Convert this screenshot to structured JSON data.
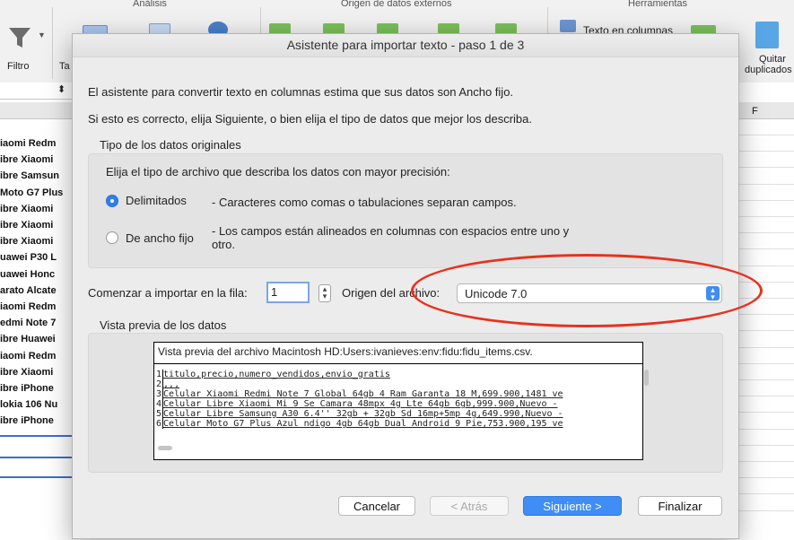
{
  "ribbon": {
    "groups": [
      "Análisis",
      "Origen de datos externos",
      "Herramientas"
    ],
    "filter_label": "Filtro",
    "ta_label": "Ta",
    "text_to_columns": "Texto en columnas",
    "remove_dup_line1": "Quitar",
    "remove_dup_line2": "duplicados"
  },
  "sheet": {
    "col_f": "F",
    "rows": [
      "iaomi Redm",
      "ibre Xiaomi",
      "ibre Samsun",
      "Moto G7 Plus",
      "ibre Xiaomi",
      "ibre Xiaomi",
      "ibre Xiaomi",
      "uawei P30 L",
      "uawei Honc",
      "arato Alcate",
      "iaomi Redm",
      "edmi Note 7",
      "ibre Huawei",
      "iaomi Redm",
      "ibre Xiaomi",
      "ibre iPhone",
      "lokia 106 Nu",
      "ibre iPhone"
    ]
  },
  "dialog": {
    "title": "Asistente para importar texto - paso 1 de 3",
    "intro1": "El asistente para convertir texto en columnas estima que sus datos son Ancho fijo.",
    "intro2": "Si esto es correcto, elija Siguiente, o bien elija el tipo de datos que mejor los describa.",
    "type_group_title": "Tipo de los datos originales",
    "type_prompt": "Elija el tipo de archivo que describa los datos con mayor precisión:",
    "opt_delimited": "Delimitados",
    "opt_delimited_desc": "- Caracteres como comas o tabulaciones separan campos.",
    "opt_fixed": "De ancho fijo",
    "opt_fixed_desc_line1": "- Los campos están alineados en columnas con espacios entre uno y",
    "opt_fixed_desc_line2": "otro.",
    "start_row_label": "Comenzar a importar en la fila:",
    "start_row_value": "1",
    "origin_label": "Origen del archivo:",
    "origin_value": "Unicode 7.0",
    "preview_group_title": "Vista previa de los datos",
    "preview_header": "Vista previa del archivo Macintosh HD:Users:ivanieves:env:fidu:fidu_items.csv.",
    "preview_lines": [
      {
        "num": "1",
        "text": "titulo,precio,numero_vendidos,envio_gratis"
      },
      {
        "num": "2",
        "text": ",,,"
      },
      {
        "num": "3",
        "text": "Celular Xiaomi Redmi Note 7 Global 64gb 4 Ram Garanta 18 M,699.900,1481 ve"
      },
      {
        "num": "4",
        "text": "Celular Libre Xiaomi Mi 9 Se Camara 48mpx 4g Lte 64gb 6gb,999.900,Nuevo -"
      },
      {
        "num": "5",
        "text": "Celular Libre Samsung A30 6.4'' 32gb + 32gb Sd 16mp+5mp 4g,649.990,Nuevo -"
      },
      {
        "num": "6",
        "text": "Celular Moto G7 Plus Azul ndigo 4gb 64gb Dual Android 9 Pie,753.900,195 ve"
      }
    ],
    "buttons": {
      "cancel": "Cancelar",
      "back": "< Atrás",
      "next": "Siguiente >",
      "finish": "Finalizar"
    }
  }
}
